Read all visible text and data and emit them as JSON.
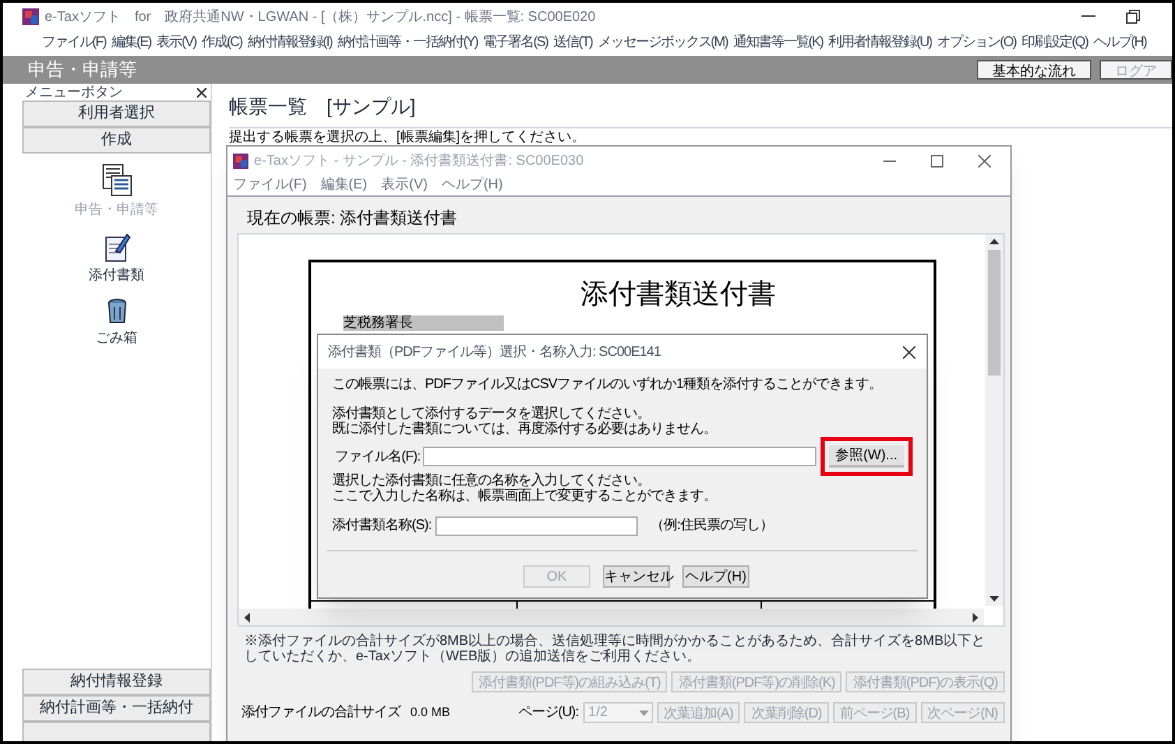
{
  "main_window": {
    "title": "e-Taxソフト　for　政府共通NW・LGWAN - [（株）サンプル.ncc] - 帳票一覧: SC00E020",
    "menu": [
      "ファイル(F)",
      "編集(E)",
      "表示(V)",
      "作成(C)",
      "納付情報登録(I)",
      "納付計画等・一括納付(Y)",
      "電子署名(S)",
      "送信(T)",
      "メッセージボックス(M)",
      "通知書等一覧(K)",
      "利用者情報登録(U)",
      "オプション(O)",
      "印刷設定(Q)",
      "ヘルプ(H)"
    ]
  },
  "header": {
    "title": "申告・申請等",
    "buttons": [
      {
        "label": "基本的な流れ",
        "disabled": false
      },
      {
        "label": "ログア",
        "disabled": true
      }
    ]
  },
  "menu_panel": {
    "title": "メニューボタン",
    "top_buttons": [
      "利用者選択",
      "作成"
    ],
    "items": [
      {
        "label": "申告・申請等",
        "kind": "forms",
        "disabled": true
      },
      {
        "label": "添付書類",
        "kind": "attachment",
        "disabled": false
      },
      {
        "label": "ごみ箱",
        "kind": "trash",
        "disabled": false
      }
    ],
    "bottom_buttons": [
      "納付情報登録",
      "納付計画等・一括納付"
    ]
  },
  "form_list": {
    "title": "帳票一覧　[サンプル]",
    "instruction": "提出する帳票を選択の上、[帳票編集]を押してください。"
  },
  "attachment_window": {
    "title": "e-Taxソフト - サンプル - 添付書類送付書: SC00E030",
    "menu": [
      "ファイル(F)",
      "編集(E)",
      "表示(V)",
      "ヘルプ(H)"
    ],
    "current_form": "現在の帳票: 添付書類送付書",
    "document": {
      "heading": "添付書類送付書",
      "addressee": "芝税務署長"
    },
    "note": "※添付ファイルの合計サイズが8MB以上の場合、送信処理等に時間がかかることがあるため、合計サイズを8MB以下としていただくか、e-Taxソフト（WEB版）の追加送信をご利用ください。",
    "action_buttons": [
      {
        "label": "添付書類(PDF等)の組み込み(T)",
        "disabled": true
      },
      {
        "label": "添付書類(PDF等)の削除(K)",
        "disabled": true
      },
      {
        "label": "添付書類(PDF)の表示(Q)",
        "disabled": true
      }
    ],
    "total_size_label": "添付ファイルの合計サイズ",
    "total_size": "0.0 MB",
    "page_label": "ページ(U):",
    "page_value": "1/2",
    "page_buttons": [
      {
        "label": "次葉追加(A)",
        "disabled": true
      },
      {
        "label": "次葉削除(D)",
        "disabled": true
      },
      {
        "label": "前ページ(B)",
        "disabled": true
      },
      {
        "label": "次ページ(N)",
        "disabled": true
      }
    ]
  },
  "dialog": {
    "title": "添付書類（PDFファイル等）選択・名称入力: SC00E141",
    "intro": "この帳票には、PDFファイル又はCSVファイルのいずれか1種類を添付することができます。",
    "file_instruction": [
      "添付書類として添付するデータを選択してください。",
      "既に添付した書類については、再度添付する必要はありません。"
    ],
    "file_label": "ファイル名(F):",
    "browse_button": {
      "label": "参照(W)...",
      "highlighted": true
    },
    "name_instruction": [
      "選択した添付書類に任意の名称を入力してください。",
      "ここで入力した名称は、帳票画面上で変更することができます。"
    ],
    "name_label": "添付書類名称(S):",
    "name_example": "（例:住民票の写し）",
    "buttons": [
      {
        "label": "OK",
        "disabled": true
      },
      {
        "label": "キャンセル",
        "disabled": false
      },
      {
        "label": "ヘルプ(H)",
        "disabled": false
      }
    ]
  }
}
